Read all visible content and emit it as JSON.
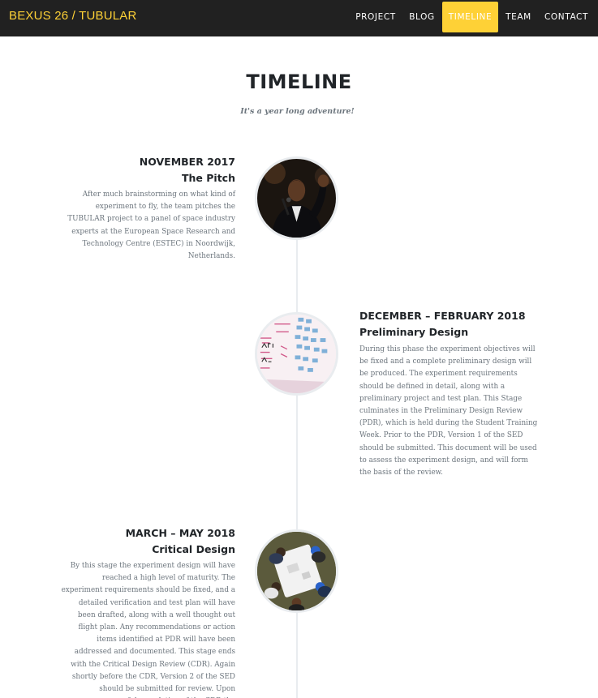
{
  "nav": {
    "brand": "BEXUS 26 / TUBULAR",
    "items": [
      "PROJECT",
      "BLOG",
      "TIMELINE",
      "TEAM",
      "CONTACT"
    ],
    "active": "TIMELINE"
  },
  "page": {
    "title": "TIMELINE",
    "subtitle": "It's a year long adventure!"
  },
  "timeline": [
    {
      "date": "NOVEMBER 2017",
      "title": "The Pitch",
      "text": "After much brainstorming on what kind of experiment to fly, the team pitches the TUBULAR project to a panel of space industry experts at the European Space Research and Technology Centre (ESTEC) in Noordwijk, Netherlands.",
      "image_icon": "speaker-photo"
    },
    {
      "date": "DECEMBER – FEBRUARY 2018",
      "title": "Preliminary Design",
      "text": "During this phase the experiment objectives will be fixed and a complete preliminary design will be produced. The experiment requirements should be defined in detail, along with a preliminary project and test plan. This Stage culminates in the Preliminary Design Review (PDR), which is held during the Student Training Week. Prior to the PDR, Version 1 of the SED should be submitted. This document will be used to assess the experiment design, and will form the basis of the review.",
      "image_icon": "whiteboard-photo"
    },
    {
      "date": "MARCH – MAY 2018",
      "title": "Critical Design",
      "text": "By this stage the experiment design will have reached a high level of maturity. The experiment requirements should be fixed, and a detailed verification and test plan will have been drafted, along with a well thought out flight plan. Any recommendations or action items identified at PDR will have been addressed and documented. This stage ends with the Critical Design Review (CDR). Again shortly before the CDR, Version 2 of the SED should be submitted for review. Upon successful completion of the CDR the experiment design will",
      "image_icon": "meeting-photo"
    }
  ],
  "colors": {
    "accent": "#fed136",
    "navbar": "#212121",
    "heading": "#212529",
    "muted": "#6c757d",
    "line": "#e9ecef"
  }
}
